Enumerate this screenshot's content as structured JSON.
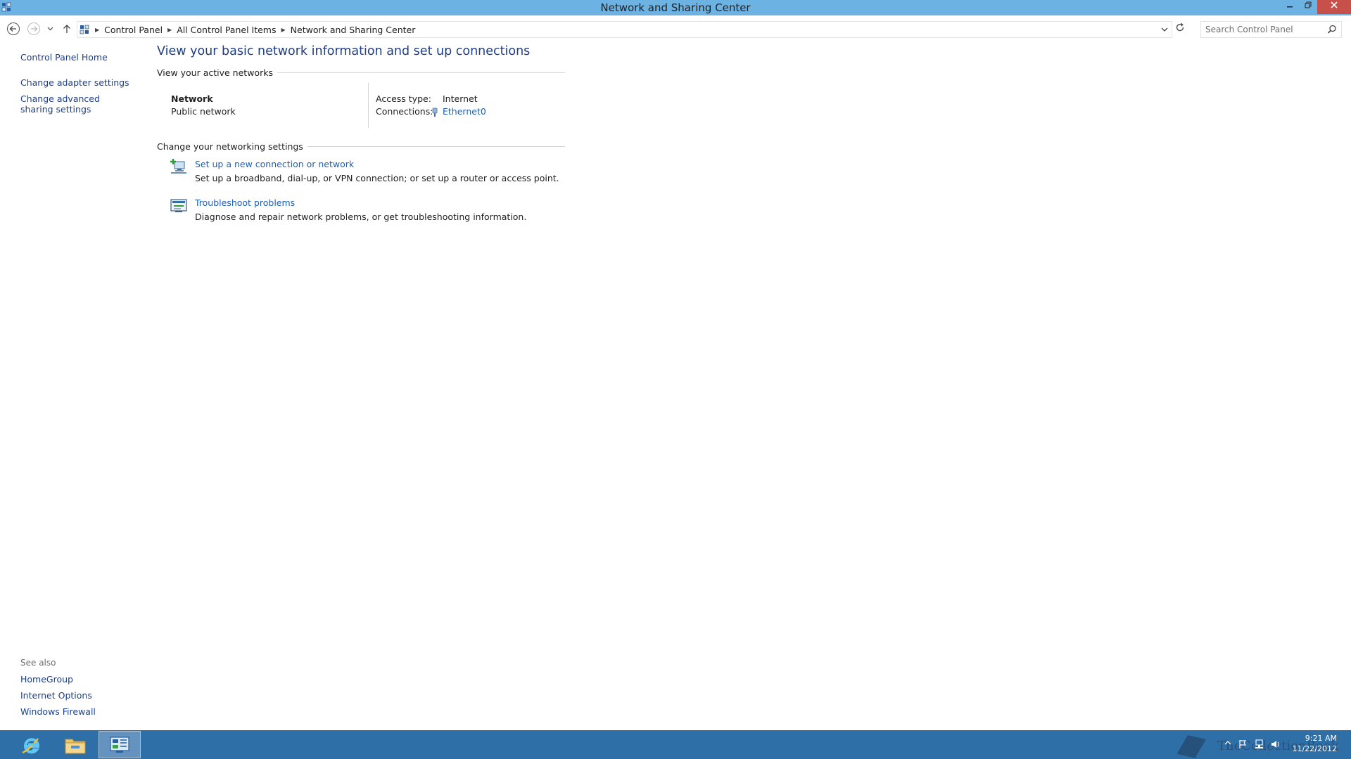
{
  "window": {
    "title": "Network and Sharing Center"
  },
  "address_bar": {
    "breadcrumbs": [
      "Control Panel",
      "All Control Panel Items",
      "Network and Sharing Center"
    ]
  },
  "search": {
    "placeholder": "Search Control Panel"
  },
  "left_pane": {
    "home": "Control Panel Home",
    "links": [
      "Change adapter settings",
      "Change advanced sharing settings"
    ],
    "see_also_title": "See also",
    "see_also": [
      "HomeGroup",
      "Internet Options",
      "Windows Firewall"
    ]
  },
  "main": {
    "title": "View your basic network information and set up connections",
    "active_networks_header": "View your active networks",
    "network": {
      "name": "Network",
      "type": "Public network",
      "access_label": "Access type:",
      "access_value": "Internet",
      "connections_label": "Connections:",
      "connections_value": "Ethernet0"
    },
    "settings_header": "Change your networking settings",
    "tasks": [
      {
        "title": "Set up a new connection or network",
        "description": "Set up a broadband, dial-up, or VPN connection; or set up a router or access point.",
        "icon": "new-connection-icon"
      },
      {
        "title": "Troubleshoot problems",
        "description": "Diagnose and repair network problems, or get troubleshooting information.",
        "icon": "troubleshoot-icon"
      }
    ]
  },
  "taskbar": {
    "apps": [
      "internet-explorer-icon",
      "file-explorer-icon",
      "control-panel-icon"
    ],
    "time": "9:21 AM",
    "date": "11/22/2012",
    "watermark": "TheCollectionBook"
  },
  "colors": {
    "titlebar": "#6cb2e2",
    "taskbar": "#2f6fa8",
    "close": "#c7504a",
    "heading": "#1e3d83",
    "link": "#1d5fb4"
  }
}
